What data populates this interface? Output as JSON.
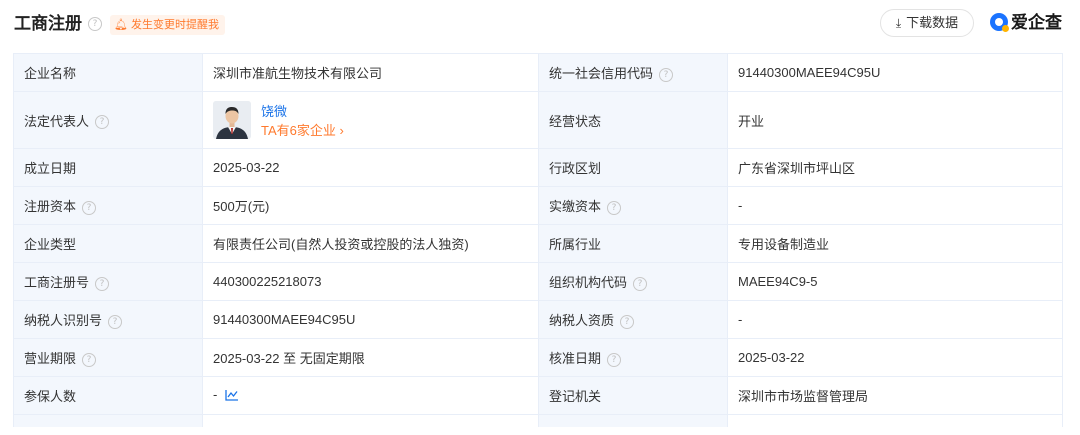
{
  "header": {
    "title": "工商注册",
    "remind_label": "发生变更时提醒我",
    "download_label": "下载数据",
    "brand": "爱企查"
  },
  "colors": {
    "accent_blue": "#1a73e8",
    "accent_orange": "#ff7a2e",
    "label_bg": "#f3f7fd",
    "border": "#e8eef8"
  },
  "rows": [
    {
      "l1": "企业名称",
      "v1": "深圳市准航生物技术有限公司",
      "l2": "统一社会信用代码",
      "v2": "91440300MAEE94C95U"
    },
    {
      "l1": "法定代表人",
      "rep_name": "饶微",
      "rep_more": "TA有6家企业 ›",
      "l2": "经营状态",
      "v2": "开业"
    },
    {
      "l1": "成立日期",
      "v1": "2025-03-22",
      "l2": "行政区划",
      "v2": "广东省深圳市坪山区"
    },
    {
      "l1": "注册资本",
      "v1": "500万(元)",
      "l2": "实缴资本",
      "v2": "-"
    },
    {
      "l1": "企业类型",
      "v1": "有限责任公司(自然人投资或控股的法人独资)",
      "l2": "所属行业",
      "v2": "专用设备制造业"
    },
    {
      "l1": "工商注册号",
      "v1": "440300225218073",
      "l2": "组织机构代码",
      "v2": "MAEE94C9-5"
    },
    {
      "l1": "纳税人识别号",
      "v1": "91440300MAEE94C95U",
      "l2": "纳税人资质",
      "v2": "-"
    },
    {
      "l1": "营业期限",
      "v1": "2025-03-22 至 无固定期限",
      "l2": "核准日期",
      "v2": "2025-03-22"
    },
    {
      "l1": "参保人数",
      "v1": "-",
      "l2": "登记机关",
      "v2": "深圳市市场监督管理局"
    }
  ]
}
